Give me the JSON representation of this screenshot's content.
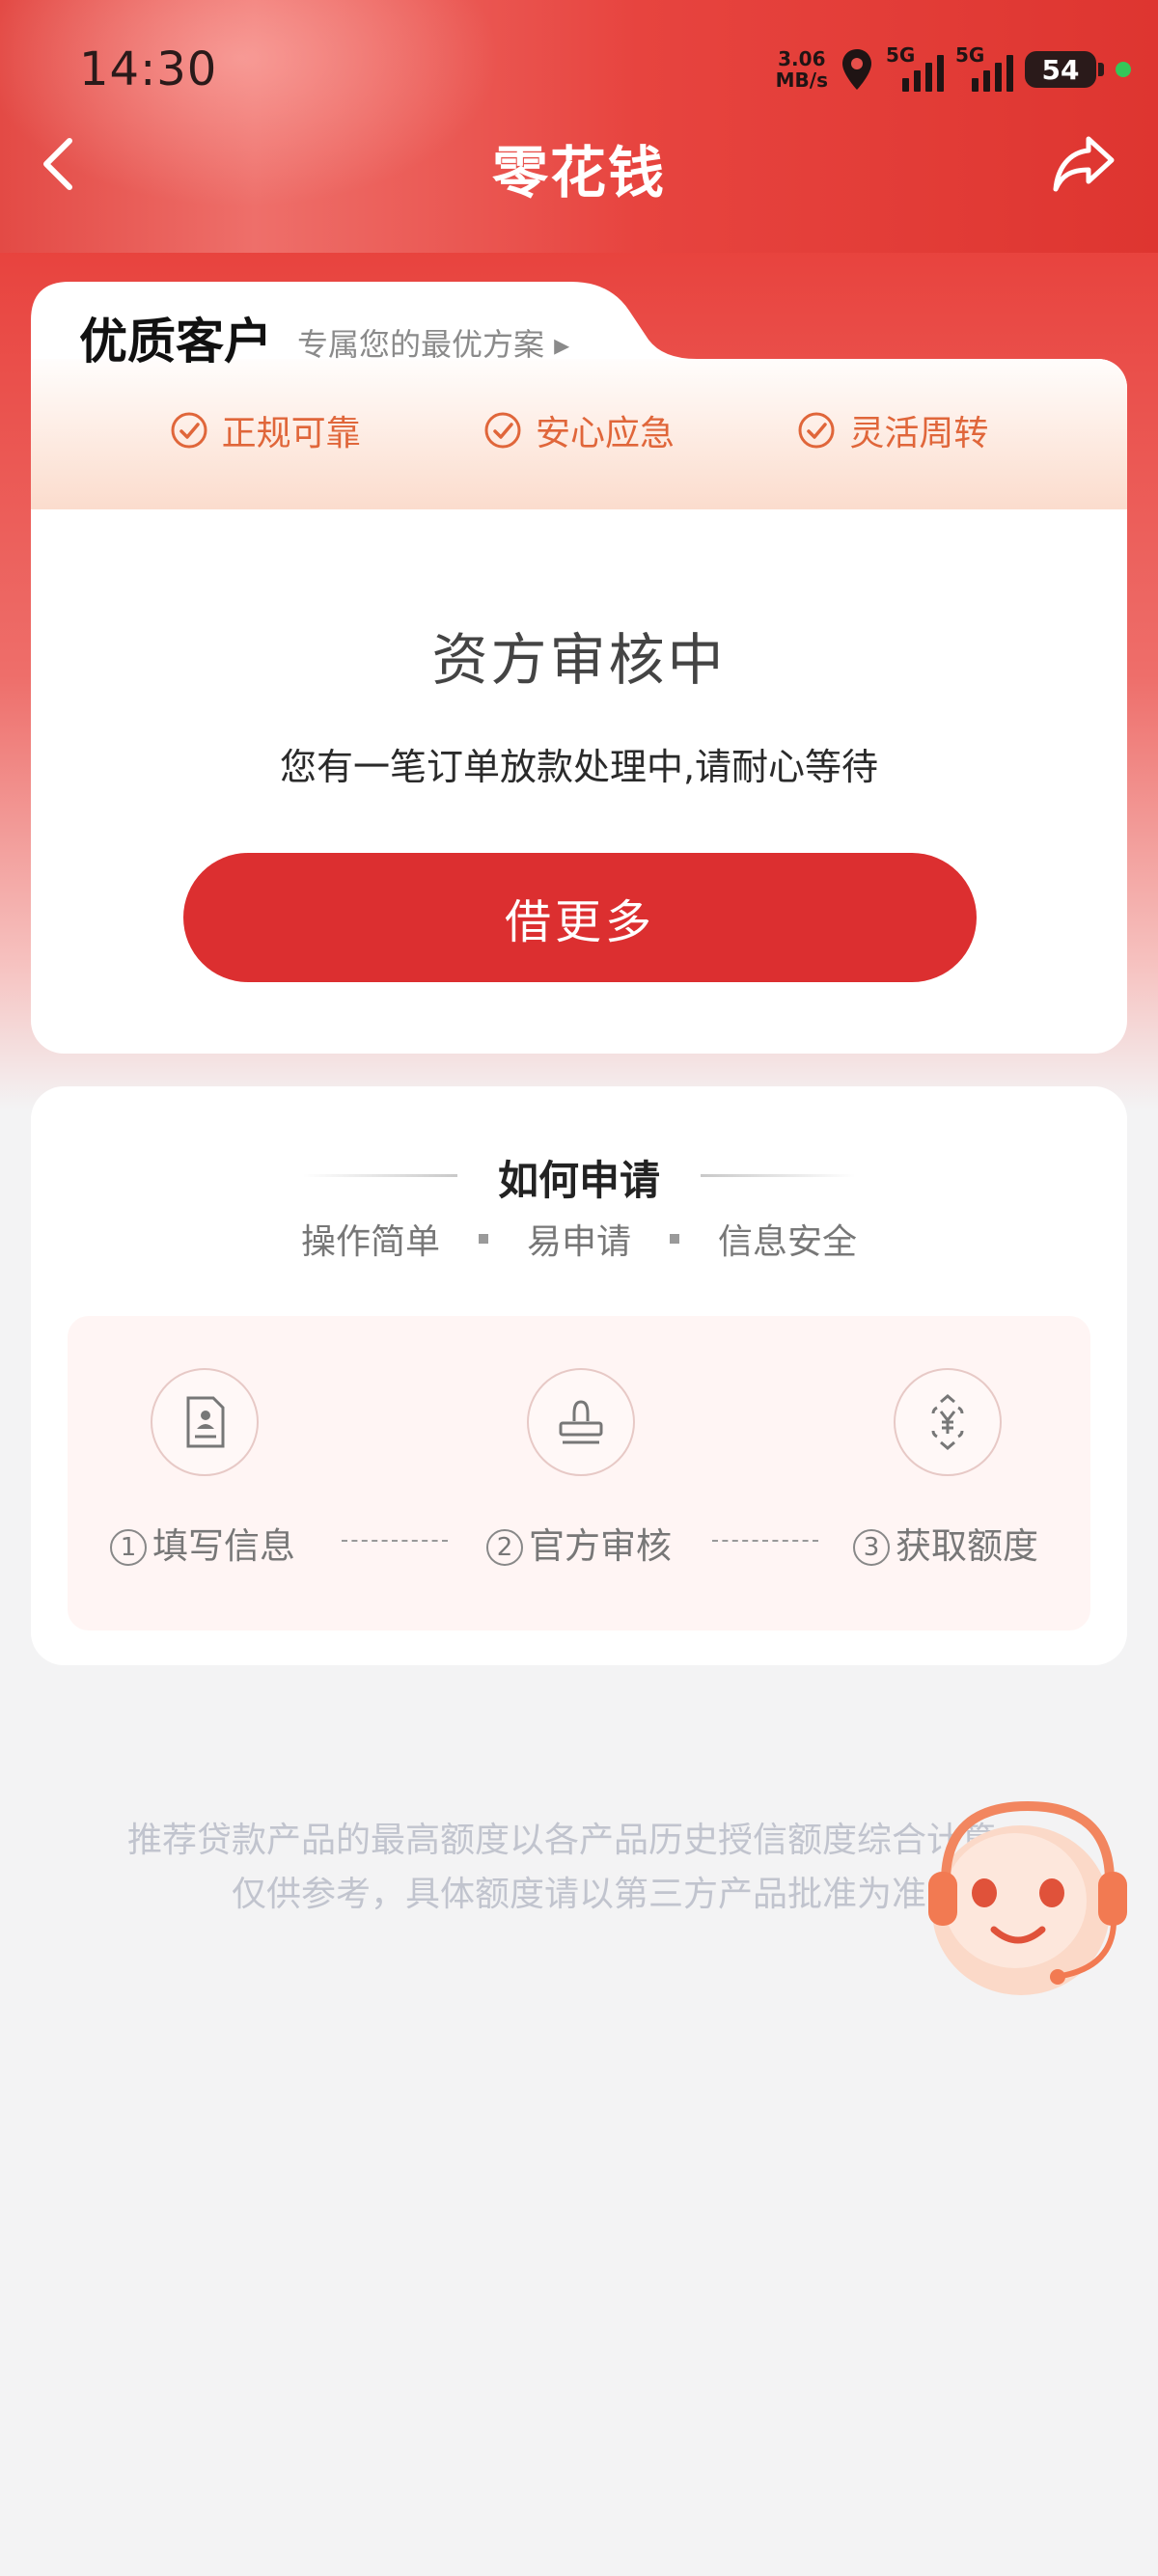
{
  "status_bar": {
    "time": "14:30",
    "net_speed_value": "3.06",
    "net_speed_unit": "MB/s",
    "sim1_label": "5G",
    "sim2_label": "5G",
    "battery": "54"
  },
  "nav": {
    "title": "零花钱"
  },
  "vip_card": {
    "title": "优质客户",
    "subtitle": "专属您的最优方案 ▸",
    "features": [
      "正规可靠",
      "安心应急",
      "灵活周转"
    ],
    "status_title": "资方审核中",
    "status_desc": "您有一笔订单放款处理中,请耐心等待",
    "button_label": "借更多"
  },
  "howto": {
    "title": "如何申请",
    "tags": [
      "操作简单",
      "易申请",
      "信息安全"
    ],
    "steps": [
      {
        "num": "1",
        "label": "填写信息",
        "icon": "form-icon"
      },
      {
        "num": "2",
        "label": "官方审核",
        "icon": "stamp-icon"
      },
      {
        "num": "3",
        "label": "获取额度",
        "icon": "yuan-icon"
      }
    ]
  },
  "disclaimer": "推荐贷款产品的最高额度以各产品历史授信额度综合计算，仅供参考，具体额度请以第三方产品批准为准",
  "colors": {
    "brand_red": "#dc2f30",
    "header_red": "#e6423d",
    "feature_orange": "#e0663a",
    "page_bg": "#f3f3f4"
  }
}
